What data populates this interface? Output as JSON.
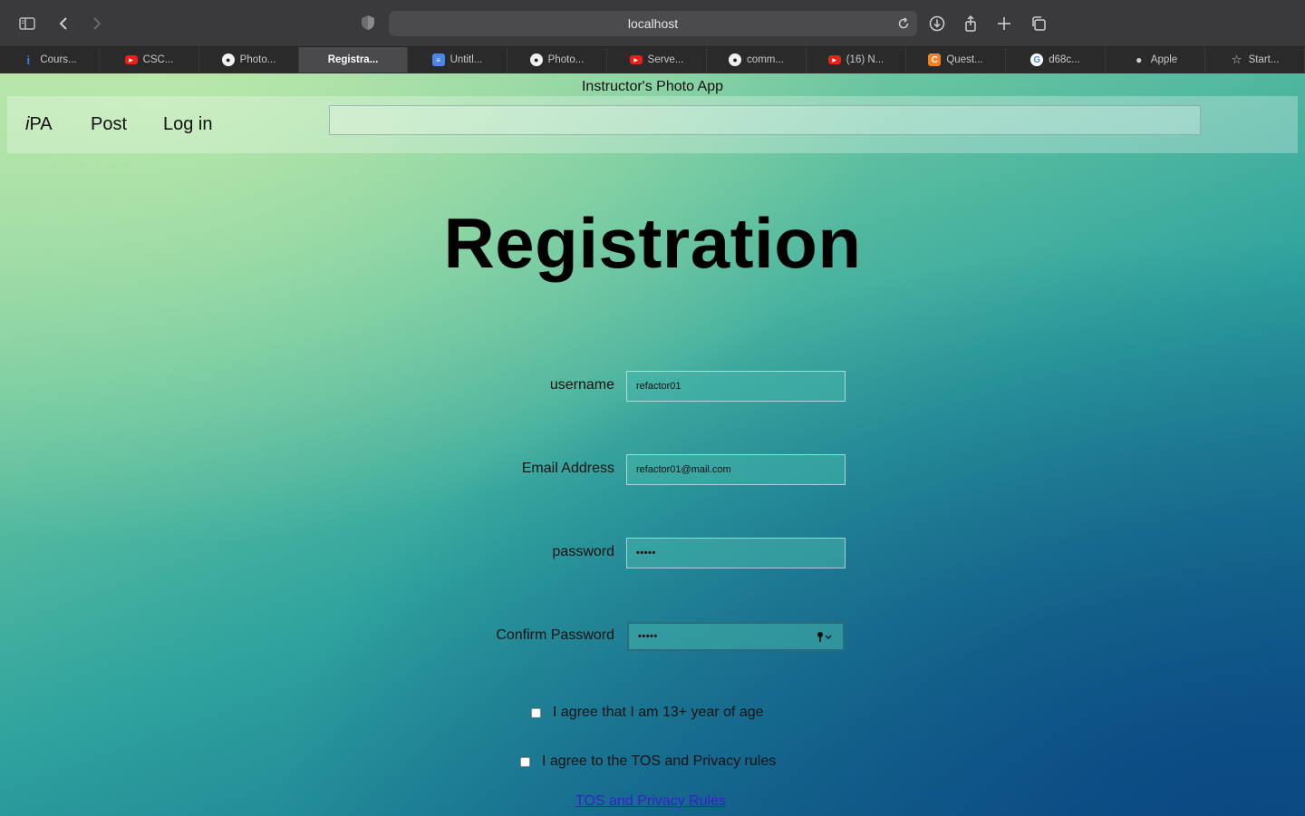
{
  "browser": {
    "url": "localhost",
    "tabs": [
      {
        "label": "Cours...",
        "icon": "info-icon",
        "active": false
      },
      {
        "label": "CSC...",
        "icon": "youtube-icon",
        "active": false
      },
      {
        "label": "Photo...",
        "icon": "github-icon",
        "active": false
      },
      {
        "label": "Registra...",
        "icon": "",
        "active": true
      },
      {
        "label": "Untitl...",
        "icon": "google-docs-icon",
        "active": false
      },
      {
        "label": "Photo...",
        "icon": "github-icon",
        "active": false
      },
      {
        "label": "Serve...",
        "icon": "youtube-icon",
        "active": false
      },
      {
        "label": "comm...",
        "icon": "github-icon",
        "active": false
      },
      {
        "label": "(16) N...",
        "icon": "youtube-icon",
        "active": false
      },
      {
        "label": "Quest...",
        "icon": "chegg-icon",
        "active": false
      },
      {
        "label": "d68c...",
        "icon": "google-icon",
        "active": false
      },
      {
        "label": "Apple",
        "icon": "apple-icon",
        "active": false
      },
      {
        "label": "Start...",
        "icon": "star-icon",
        "active": false
      }
    ]
  },
  "page": {
    "app_title": "Instructor's Photo App",
    "nav": {
      "brand_i": "i",
      "brand_rest": "PA",
      "post": "Post",
      "login": "Log in",
      "search_value": ""
    },
    "title": "Registration",
    "form": {
      "username_label": "username",
      "username_value": "refactor01",
      "email_label": "Email Address",
      "email_value": "refactor01@mail.com",
      "password_label": "password",
      "password_value": "•••••",
      "confirm_label": "Confirm Password",
      "confirm_value": "•••••",
      "age_check_label": "I agree that I am 13+ year of age",
      "tos_check_label": "I agree to the TOS and Privacy rules",
      "tos_link": "TOS and Privacy Rules "
    }
  }
}
